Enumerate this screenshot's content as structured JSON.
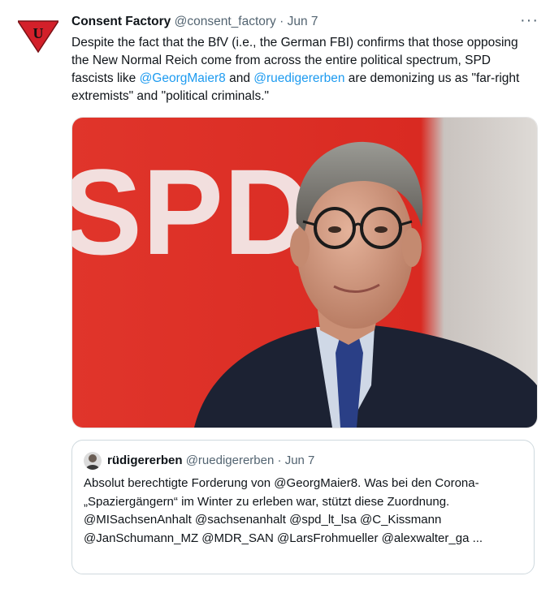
{
  "tweet": {
    "display_name": "Consent Factory",
    "handle": "@consent_factory",
    "separator": "·",
    "date": "Jun 7",
    "more_label": "···",
    "avatar_letter": "U",
    "text_parts": {
      "p1": "Despite the fact that the BfV (i.e., the German FBI) confirms that those opposing the New Normal Reich come from across the entire political spectrum, SPD fascists like ",
      "m1": "@GeorgMaier8",
      "p2": " and ",
      "m2": "@ruedigererben",
      "p3": " are demonizing us as \"far-right extremists\" and \"political criminals.\""
    },
    "photo_sign_text": "SPD"
  },
  "quote": {
    "display_name": "rüdigererben",
    "handle": "@ruedigererben",
    "separator": "·",
    "date": "Jun 7",
    "text": "Absolut berechtigte Forderung von @GeorgMaier8. Was  bei den Corona-„Spaziergängern“ im Winter zu erleben war, stützt diese Zuordnung. @MISachsenAnhalt @sachsenanhalt @spd_lt_lsa @C_Kissmann @JanSchumann_MZ @MDR_SAN @LarsFrohmueller @alexwalter_ga ..."
  },
  "colors": {
    "link": "#1d9bf0",
    "secondary_text": "#536471",
    "avatar_red": "#d3202a",
    "photo_red": "#e2332a"
  }
}
